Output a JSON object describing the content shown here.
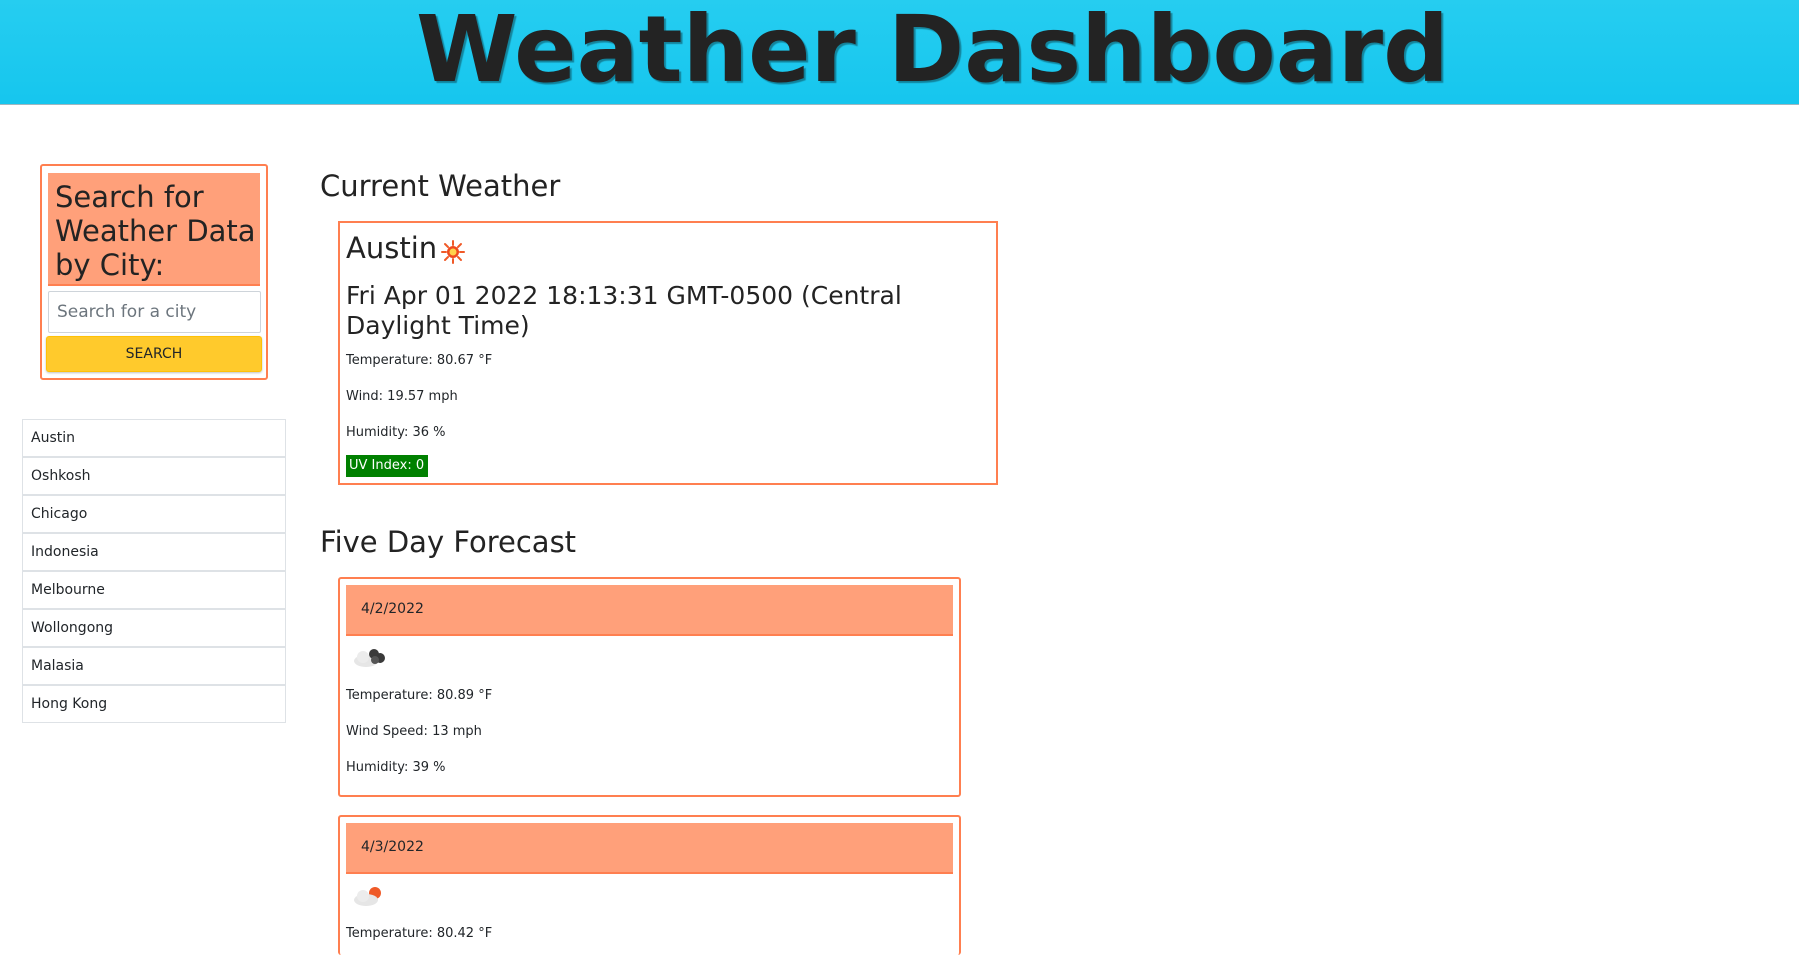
{
  "header": {
    "title": "Weather Dashboard"
  },
  "search": {
    "title": "Search for Weather Data by City:",
    "placeholder": "Search for a city",
    "button_label": "SEARCH"
  },
  "history": [
    "Austin",
    "Oshkosh",
    "Chicago",
    "Indonesia",
    "Melbourne",
    "Wollongong",
    "Malasia",
    "Hong Kong"
  ],
  "current": {
    "heading": "Current Weather",
    "city": "Austin",
    "icon": "sun-icon",
    "datetime": "Fri Apr 01 2022 18:13:31 GMT-0500 (Central Daylight Time)",
    "temperature": "Temperature: 80.67 °F",
    "wind": "Wind: 19.57 mph",
    "humidity": "Humidity: 36 %",
    "uv_index": "UV Index: 0",
    "uv_color": "#008000"
  },
  "forecast": {
    "heading": "Five Day Forecast",
    "days": [
      {
        "date": "4/2/2022",
        "icon": "broken-clouds-icon",
        "temperature": "Temperature: 80.89 °F",
        "wind": "Wind Speed: 13 mph",
        "humidity": "Humidity: 39 %"
      },
      {
        "date": "4/3/2022",
        "icon": "partly-cloudy-icon",
        "temperature": "Temperature: 80.42 °F"
      }
    ]
  },
  "colors": {
    "header_bg": "#1cc9ef",
    "accent_border": "#ff7f50",
    "card_header_bg": "#ffa07a",
    "search_button_bg": "#ffca2c"
  }
}
